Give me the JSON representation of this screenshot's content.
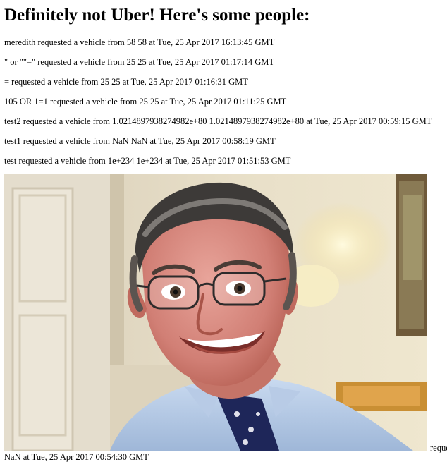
{
  "page": {
    "title": "Definitely not Uber! Here's some people:"
  },
  "requests": [
    {
      "text": "meredith requested a vehicle from 58 58 at Tue, 25 Apr 2017 16:13:45 GMT"
    },
    {
      "text": "\" or \"\"=\" requested a vehicle from 25 25 at Tue, 25 Apr 2017 01:17:14 GMT"
    },
    {
      "text": "= requested a vehicle from 25 25 at Tue, 25 Apr 2017 01:16:31 GMT"
    },
    {
      "text": "105 OR 1=1 requested a vehicle from 25 25 at Tue, 25 Apr 2017 01:11:25 GMT"
    },
    {
      "text": "test2 requested a vehicle from 1.0214897938274982e+80 1.0214897938274982e+80 at Tue, 25 Apr 2017 00:59:15 GMT"
    },
    {
      "text": "test1 requested a vehicle from NaN NaN at Tue, 25 Apr 2017 00:58:19 GMT"
    },
    {
      "text": "test requested a vehicle from 1e+234 1e+234 at Tue, 25 Apr 2017 01:51:53 GMT"
    }
  ],
  "photo_entry": {
    "trailing_text": "reque",
    "continuation_text": "NaN at Tue, 25 Apr 2017 00:54:30 GMT"
  }
}
